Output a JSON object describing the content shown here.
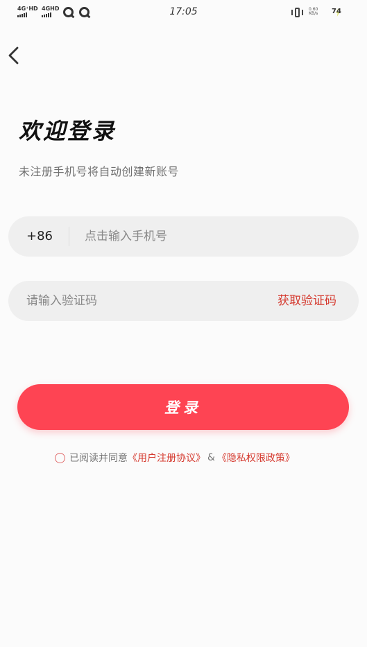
{
  "status_bar": {
    "sim1": "4G⁺HD",
    "sim2": "4GHD",
    "time": "17:05",
    "net_speed_value": "0.60",
    "net_speed_unit": "KB/s",
    "battery": "74"
  },
  "header": {
    "back_icon": "chevron-left-icon"
  },
  "page": {
    "title": "欢迎登录",
    "subtitle": "未注册手机号将自动创建新账号"
  },
  "phone_field": {
    "prefix": "+86",
    "placeholder": "点击输入手机号",
    "value": ""
  },
  "code_field": {
    "placeholder": "请输入验证码",
    "value": "",
    "get_code_label": "获取验证码"
  },
  "login_button": {
    "label": "登录"
  },
  "agreement": {
    "checked": false,
    "prefix_text": "已阅读并同意",
    "user_agreement": "《用户注册协议》",
    "amp": "&",
    "privacy_policy": "《隐私权限政策》"
  },
  "colors": {
    "accent": "#fe4453",
    "link": "#d5392e",
    "field_bg": "#efefef",
    "page_bg": "#fbfbfb"
  }
}
